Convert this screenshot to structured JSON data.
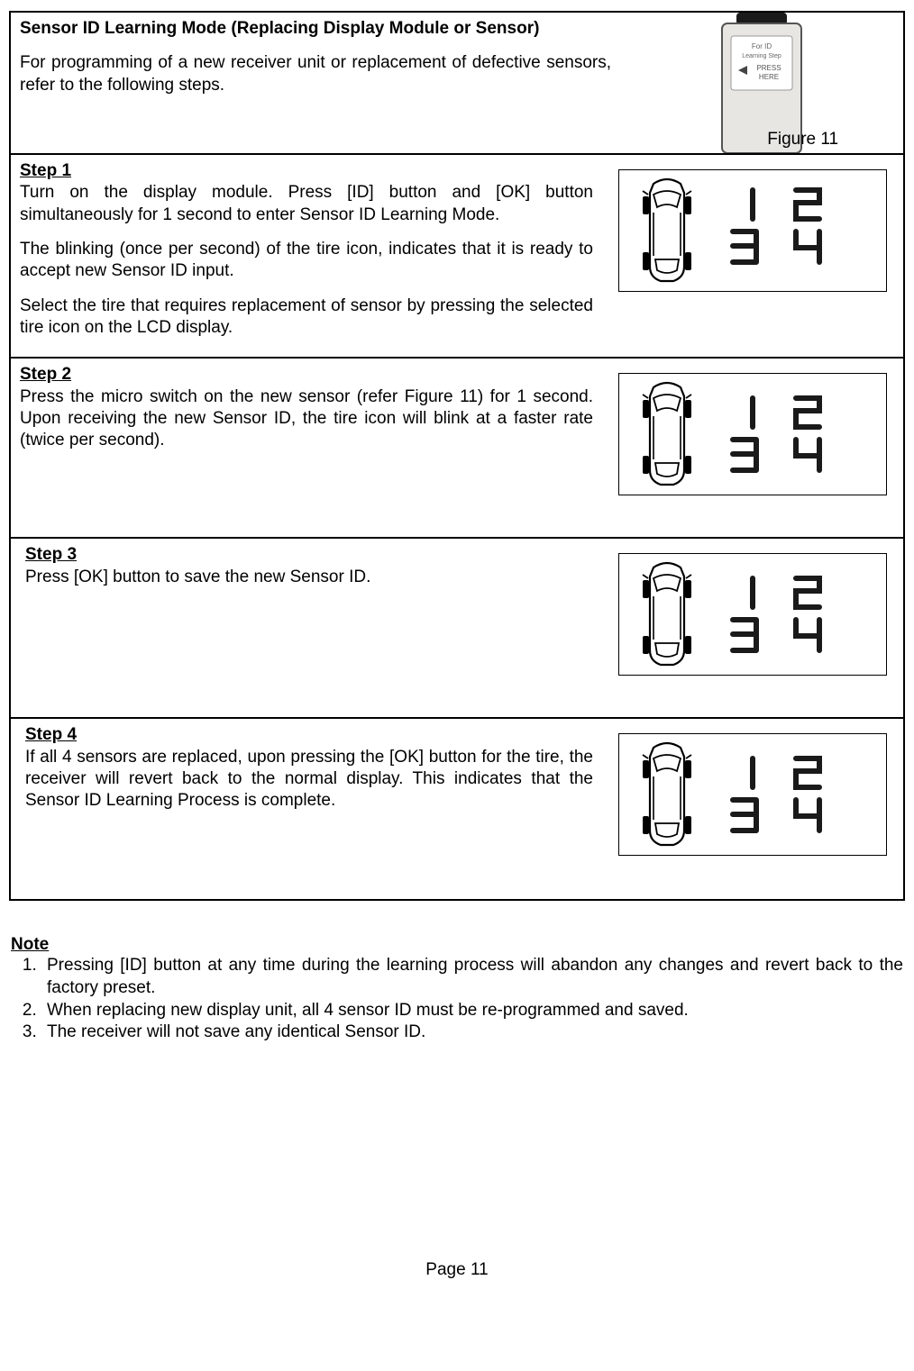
{
  "header": {
    "title": "Sensor ID Learning Mode (Replacing Display Module or Sensor)",
    "intro": "For programming of a new receiver unit or replacement of defective sensors, refer to the following steps.",
    "figure_caption": "Figure 11",
    "device_label_line1": "For ID",
    "device_label_line2": "Learning Step",
    "device_label_line3": "PRESS",
    "device_label_line4": "HERE"
  },
  "steps": [
    {
      "title": "Step 1",
      "paragraphs": [
        "Turn on the display module. Press [ID] button and [OK] button simultaneously for 1 second to enter Sensor ID Learning Mode.",
        "The blinking (once per second) of the tire icon, indicates that it is ready to accept new Sensor ID input.",
        "Select the tire that requires replacement of sensor by pressing the selected tire icon on the LCD display."
      ],
      "digits_top": "1 2",
      "digits_bottom": "3 4"
    },
    {
      "title": "Step 2",
      "paragraphs": [
        "Press the micro switch on the new sensor (refer Figure 11) for 1 second. Upon receiving the new Sensor ID, the tire icon will blink at a faster rate (twice per second)."
      ],
      "digits_top": "1 2",
      "digits_bottom": "3 4"
    },
    {
      "title": "Step 3",
      "paragraphs": [
        "Press [OK] button to save the new Sensor ID."
      ],
      "digits_top": "1 2",
      "digits_bottom": "3 4"
    },
    {
      "title": "Step 4",
      "paragraphs": [
        "If all 4 sensors are replaced, upon pressing the [OK] button for the tire, the receiver will revert back to the normal display. This indicates that the Sensor ID Learning Process is complete."
      ],
      "digits_top": "1 2",
      "digits_bottom": "3 4"
    }
  ],
  "notes": {
    "title": "Note",
    "items": [
      "Pressing [ID] button at any time during the learning process will abandon any changes and revert back to the factory preset.",
      "When replacing new display unit, all 4 sensor ID must be re-programmed and saved.",
      "The receiver will not save any identical Sensor ID."
    ]
  },
  "page_label": "Page 11"
}
